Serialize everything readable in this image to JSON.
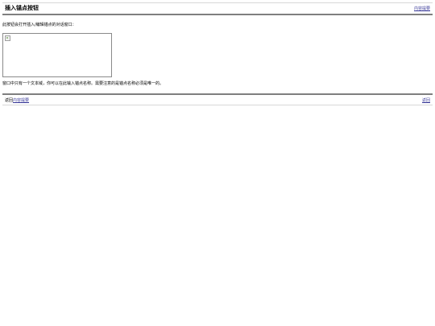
{
  "header": {
    "title": "插入锚点按钮",
    "toc_link": "内容提要"
  },
  "content": {
    "intro": "此按钮会打开插入/编辑锚点的对话窗口：",
    "description": "窗口中只有一个文本域，你可以在此输入锚点名称。需要注意的是锚点名称必须是唯一的。"
  },
  "footer": {
    "prev_prefix": "返回",
    "prev_link": "内容提要",
    "next_link": "返回"
  },
  "colors": {
    "link": "#3b3b99",
    "rule": "#7f7f7f"
  }
}
